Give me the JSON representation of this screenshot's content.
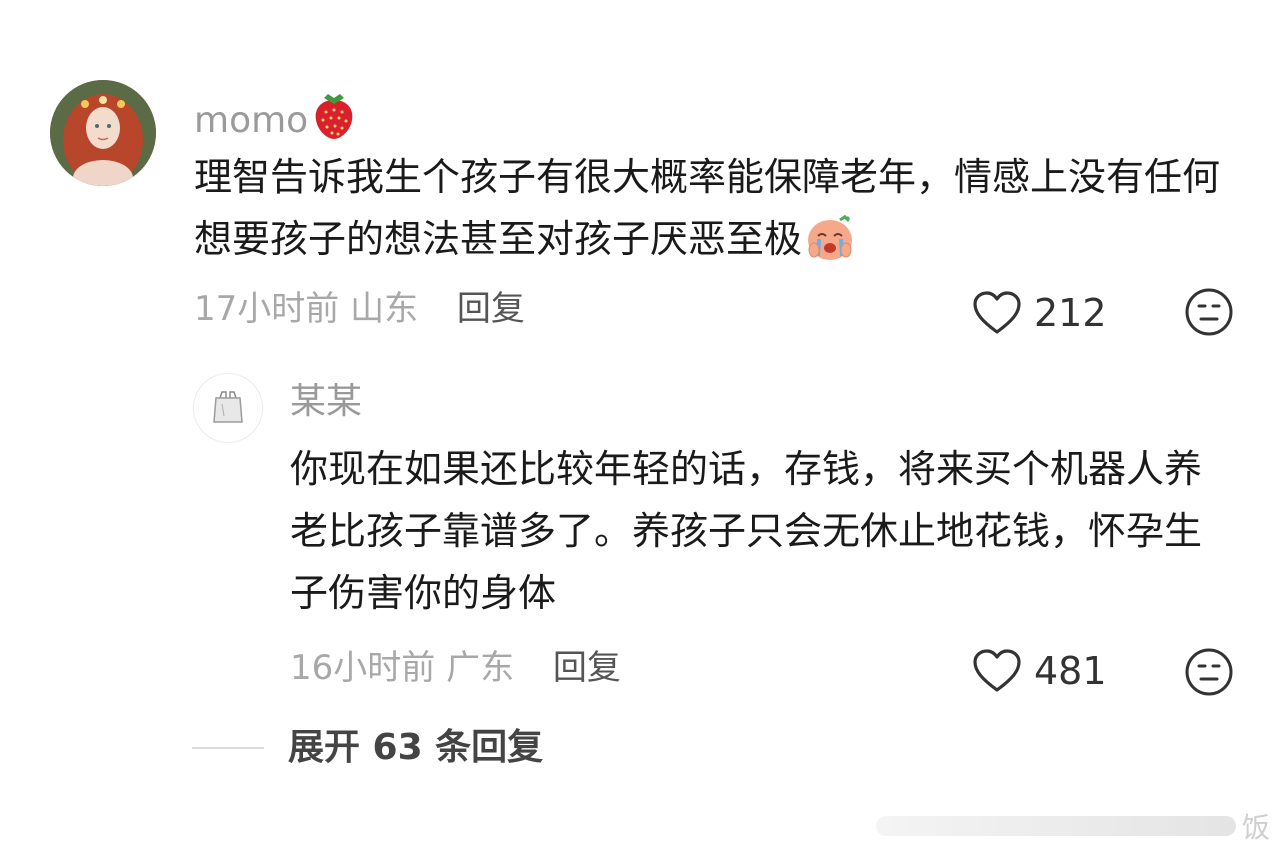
{
  "comment": {
    "username": "momo",
    "username_badge_icon": "strawberry-icon",
    "text": "理智告诉我生个孩子有很大概率能保障老年，情感上没有任何想要孩子的想法甚至对孩子厌恶至极",
    "inline_emoji_icon": "crying-face-icon",
    "time": "17小时前",
    "location": "山东",
    "reply_label": "回复",
    "likes": "212",
    "dislike_icon": "neutral-face-icon"
  },
  "reply": {
    "username": "某某",
    "avatar_icon": "shopping-bag-icon",
    "text": "你现在如果还比较年轻的话，存钱，将来买个机器人养老比孩子靠谱多了。养孩子只会无休止地花钱，怀孕生子伤害你的身体",
    "time": "16小时前",
    "location": "广东",
    "reply_label": "回复",
    "likes": "481",
    "dislike_icon": "neutral-face-icon"
  },
  "expand": {
    "label": "展开 63 条回复"
  },
  "watermark": {
    "text": "饭"
  },
  "colors": {
    "meta_gray": "#a8a8a8",
    "username_gray": "#9a9a9a",
    "text_dark": "#1a1a1a"
  }
}
